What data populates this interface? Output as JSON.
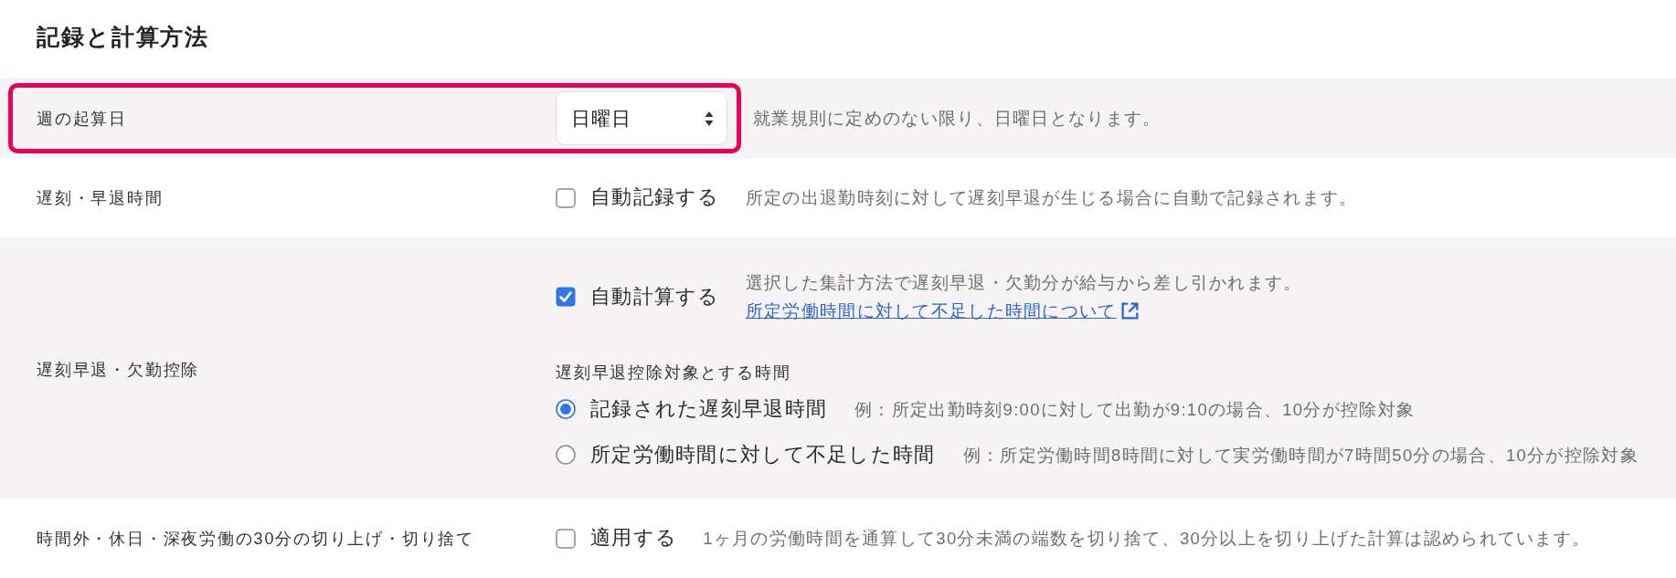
{
  "title": "記録と計算方法",
  "rows": [
    {
      "label": "週の起算日",
      "highlighted": true,
      "kind": "select",
      "value": "日曜日",
      "description": "就業規則に定めのない限り、日曜日となります。"
    },
    {
      "label": "遅刻・早退時間",
      "highlighted": false,
      "kind": "checkbox",
      "checkbox": {
        "label": "自動記録する",
        "checked": false
      },
      "description": "所定の出退勤時刻に対して遅刻早退が生じる場合に自動で記録されます。"
    },
    {
      "label": "遅刻早退・欠勤控除",
      "highlighted": false,
      "kind": "checkbox",
      "checkbox": {
        "label": "自動計算する",
        "checked": true
      },
      "description": "選択した集計方法で遅刻早退・欠勤分が給与から差し引かれます。",
      "link": "所定労働時間に対して不足した時間について",
      "radio_group": {
        "title": "遅刻早退控除対象とする時間",
        "options": [
          {
            "label": "記録された遅刻早退時間",
            "example": "例：所定出勤時刻9:00に対して出勤が9:10の場合、10分が控除対象",
            "selected": true
          },
          {
            "label": "所定労働時間に対して不足した時間",
            "example": "例：所定労働時間8時間に対して実労働時間が7時間50分の場合、10分が控除対象",
            "selected": false
          }
        ]
      }
    },
    {
      "label": "時間外・休日・深夜労働の30分の切り上げ・切り捨て",
      "highlighted": false,
      "kind": "checkbox",
      "checkbox": {
        "label": "適用する",
        "checked": false
      },
      "description": "1ヶ月の労働時間を通算して30分未満の端数を切り捨て、30分以上を切り上げた計算は認められています。"
    }
  ]
}
